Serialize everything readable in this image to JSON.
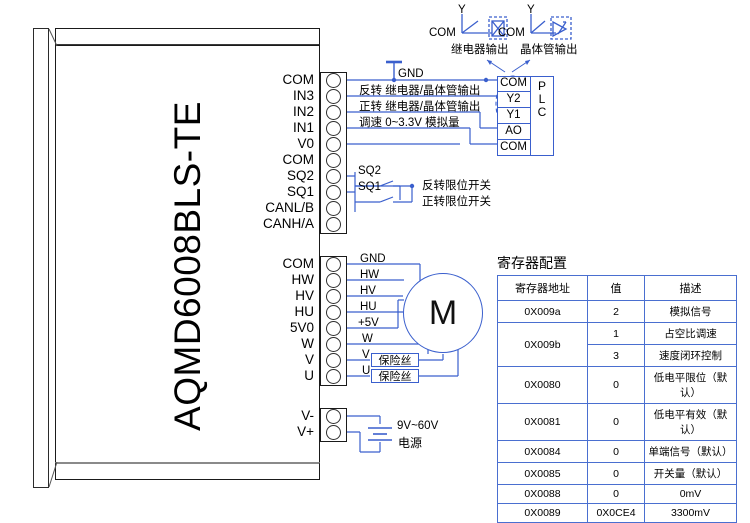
{
  "device": {
    "model": "AQMD6008BLS-TE"
  },
  "terminals": {
    "block1": [
      "COM",
      "IN3",
      "IN2",
      "IN1",
      "V0",
      "COM",
      "SQ2",
      "SQ1",
      "CANL/B",
      "CANH/A"
    ],
    "block2": [
      "COM",
      "HW",
      "HV",
      "HU",
      "5V0",
      "W",
      "V",
      "U"
    ],
    "block3": [
      "V-",
      "V+"
    ]
  },
  "wiring": {
    "gnd": "GND",
    "reverse_output": "反转 继电器/晶体管输出",
    "forward_output": "正转 继电器/晶体管输出",
    "speed_analog": "调速   0~3.3V  模拟量",
    "sq2_tag": "SQ2",
    "sq1_tag": "SQ1",
    "sq2_desc": "反转限位开关",
    "sq1_desc": "正转限位开关",
    "hall_gnd": "GND",
    "hall_hw": "HW",
    "hall_hv": "HV",
    "hall_hu": "HU",
    "hall_5v": "+5V",
    "phase_w": "W",
    "phase_v": "V",
    "phase_u": "U",
    "fuse_v": "保险丝",
    "fuse_u": "保险丝",
    "motor_symbol": "M",
    "supply_voltage": "9V~60V",
    "supply_label": "电源"
  },
  "output_types": {
    "y_left": "Y",
    "com_left": "COM",
    "relay_label": "继电器输出",
    "y_right": "Y",
    "com_right": "COM",
    "transistor_label": "晶体管输出"
  },
  "plc": {
    "name": "PLC",
    "pins": [
      "COM",
      "Y2",
      "Y1",
      "AO",
      "COM"
    ]
  },
  "register_table": {
    "title": "寄存器配置",
    "headers": [
      "寄存器地址",
      "值",
      "描述"
    ],
    "rows": [
      {
        "address": "0X009a",
        "value": "2",
        "description": "模拟信号",
        "rowspan": 1
      },
      {
        "address": "0X009b",
        "value": "1",
        "description": "占空比调速",
        "rowspan": 2
      },
      {
        "address": "",
        "value": "3",
        "description": "速度闭环控制",
        "rowspan": 0
      },
      {
        "address": "0X0080",
        "value": "0",
        "description": "低电平限位（默认）",
        "rowspan": 1
      },
      {
        "address": "0X0081",
        "value": "0",
        "description": "低电平有效（默认）",
        "rowspan": 1
      },
      {
        "address": "0X0084",
        "value": "0",
        "description": "单端信号（默认）",
        "rowspan": 1
      },
      {
        "address": "0X0085",
        "value": "0",
        "description": "开关量（默认）",
        "rowspan": 1
      },
      {
        "address": "0X0088",
        "value": "0",
        "description": "0mV",
        "rowspan": 1
      },
      {
        "address": "0X0089",
        "value": "0X0CE4",
        "description": "3300mV",
        "rowspan": 1
      }
    ]
  },
  "colors": {
    "wire": "#3a5fcd",
    "outline": "#1a1a1a",
    "table_border": "#4a6fd0"
  }
}
